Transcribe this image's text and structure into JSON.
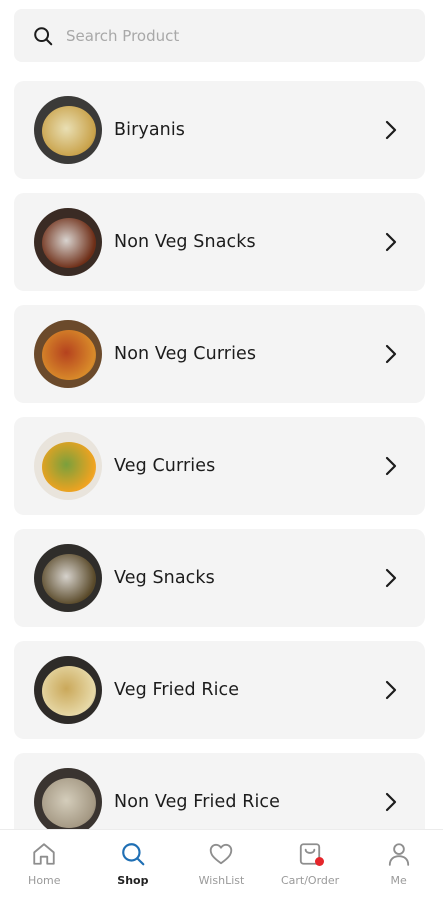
{
  "search": {
    "placeholder": "Search Product",
    "icon": "search-icon"
  },
  "categories": [
    {
      "label": "Biryanis",
      "colors": [
        "#3b3a38",
        "#c9a24a",
        "#e9dfb4"
      ]
    },
    {
      "label": "Non Veg Snacks",
      "colors": [
        "#3a2b24",
        "#6e2e17",
        "#d8d3cf"
      ]
    },
    {
      "label": "Non Veg Curries",
      "colors": [
        "#6b4a2b",
        "#d98b2a",
        "#b5421e"
      ]
    },
    {
      "label": "Veg Curries",
      "colors": [
        "#e9e4dc",
        "#f0a320",
        "#7aa03c"
      ]
    },
    {
      "label": "Veg Snacks",
      "colors": [
        "#2f2d2a",
        "#5a4a2a",
        "#d6d2cc"
      ]
    },
    {
      "label": "Veg Fried Rice",
      "colors": [
        "#2e2b28",
        "#e7d9a8",
        "#caa85a"
      ]
    },
    {
      "label": "Non Veg Fried Rice",
      "colors": [
        "#3a3430",
        "#a49883",
        "#d4cdbb"
      ]
    }
  ],
  "nav": [
    {
      "label": "Home",
      "icon": "home-icon",
      "active": false
    },
    {
      "label": "Shop",
      "icon": "search-icon",
      "active": true
    },
    {
      "label": "WishList",
      "icon": "heart-icon",
      "active": false
    },
    {
      "label": "Cart/Order",
      "icon": "cart-icon",
      "active": false,
      "badge": true
    },
    {
      "label": "Me",
      "icon": "user-icon",
      "active": false
    }
  ],
  "colors": {
    "accent": "#1f6fb4",
    "badge": "#e5262b",
    "card_bg": "#f4f4f4"
  }
}
